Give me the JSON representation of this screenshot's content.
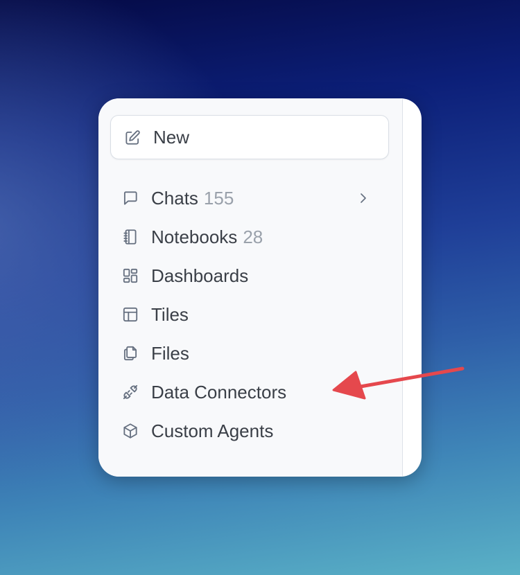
{
  "sidebar": {
    "new_button": {
      "label": "New",
      "icon": "pencil-square-icon"
    },
    "items": [
      {
        "label": "Chats",
        "count": "155",
        "icon": "chat-bubble-icon",
        "has_chevron": true
      },
      {
        "label": "Notebooks",
        "count": "28",
        "icon": "notebook-icon"
      },
      {
        "label": "Dashboards",
        "count": "",
        "icon": "dashboard-grid-icon"
      },
      {
        "label": "Tiles",
        "count": "",
        "icon": "layout-tiles-icon"
      },
      {
        "label": "Files",
        "count": "",
        "icon": "files-copy-icon"
      },
      {
        "label": "Data Connectors",
        "count": "",
        "icon": "plug-icon"
      },
      {
        "label": "Custom Agents",
        "count": "",
        "icon": "cube-icon"
      }
    ]
  },
  "annotation": {
    "arrow_color": "#e5484d",
    "points_to": "Data Connectors"
  },
  "colors": {
    "text": "#3a3f47",
    "muted_count": "#9aa1ab",
    "icon": "#667080",
    "sidebar_bg": "#f8f9fb"
  }
}
